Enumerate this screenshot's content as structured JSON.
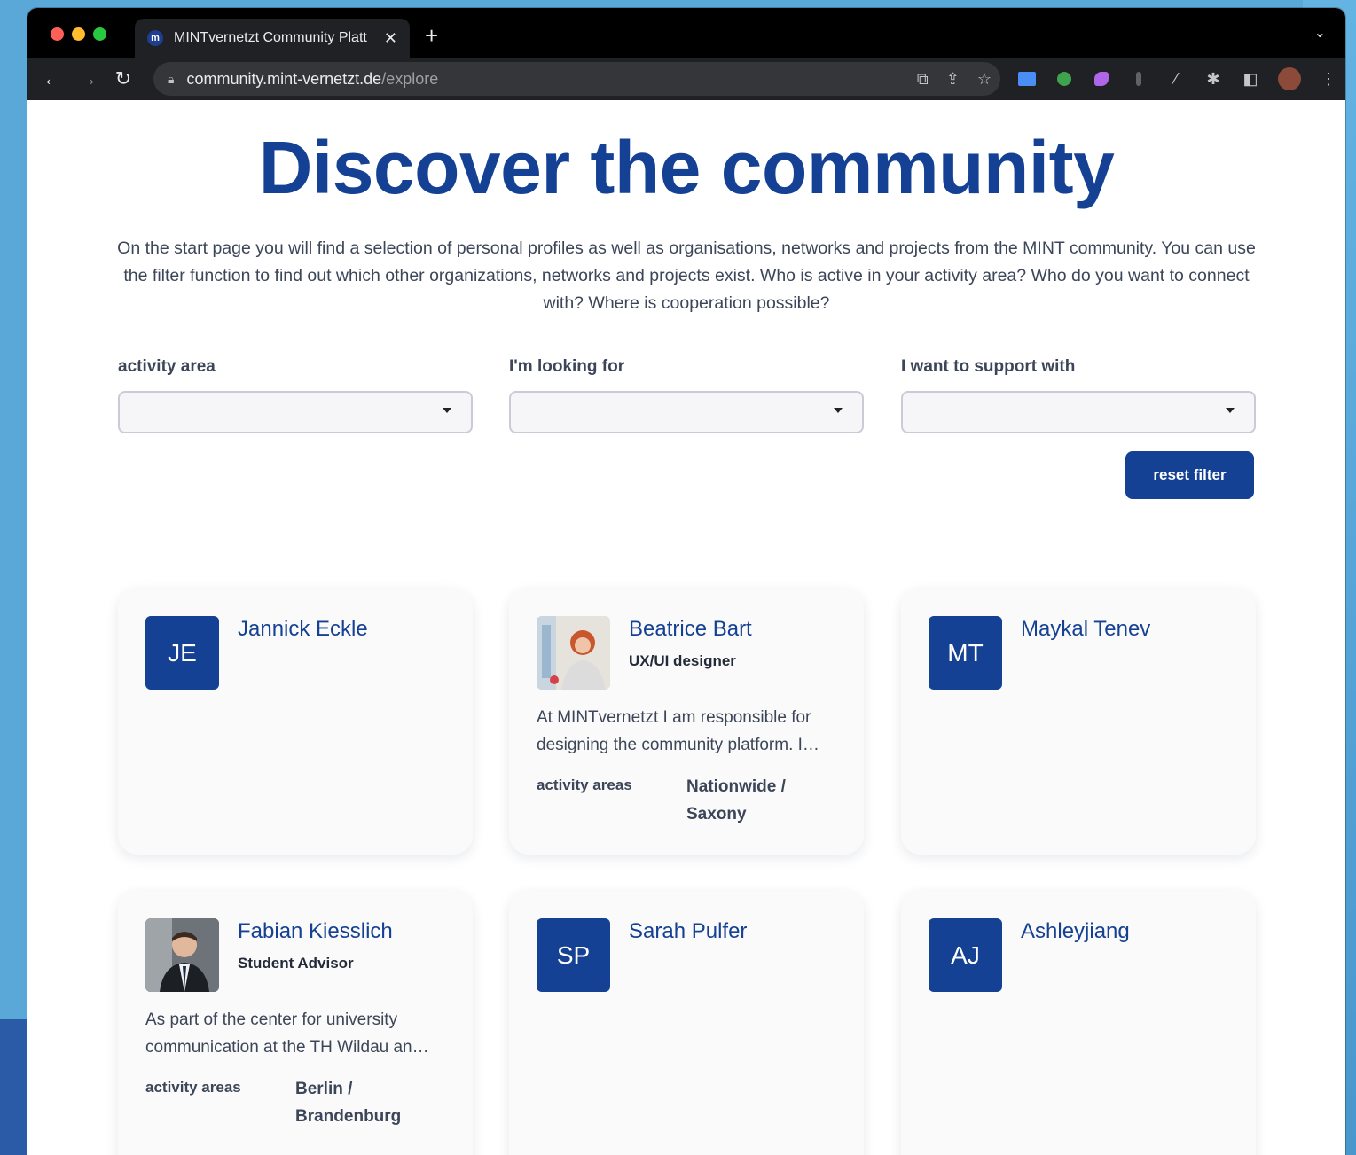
{
  "browser": {
    "tab_title": "MINTvernetzt Community Platt",
    "favicon_letter": "m",
    "url_host": "community.mint-vernetzt.de",
    "url_path": "/explore"
  },
  "page": {
    "title": "Discover the community",
    "intro": "On the start page you will find a selection of personal profiles as well as organisations, networks and projects from the MINT community. You can use the filter function to find out which other organizations, networks and projects exist. Who is active in your activity area? Who do you want to connect with? Where is cooperation possible?"
  },
  "filters": [
    {
      "label": "activity area",
      "value": ""
    },
    {
      "label": "I'm looking for",
      "value": ""
    },
    {
      "label": "I want to support with",
      "value": ""
    }
  ],
  "reset_label": "reset filter",
  "profiles": [
    {
      "initials": "JE",
      "name": "Jannick Eckle",
      "role": "",
      "bio": "",
      "areas_label": "",
      "areas": ""
    },
    {
      "initials": "",
      "name": "Beatrice Bart",
      "role": "UX/UI designer",
      "bio": "At MINTvernetzt I am responsible for designing the community platform. I…",
      "areas_label": "activity areas",
      "areas": "Nationwide / Saxony"
    },
    {
      "initials": "MT",
      "name": "Maykal Tenev",
      "role": "",
      "bio": "",
      "areas_label": "",
      "areas": ""
    },
    {
      "initials": "",
      "name": "Fabian Kiesslich",
      "role": "Student Advisor",
      "bio": "As part of the center for university communication at the TH Wildau an…",
      "areas_label": "activity areas",
      "areas": "Berlin / Brandenburg"
    },
    {
      "initials": "SP",
      "name": "Sarah Pulfer",
      "role": "",
      "bio": "",
      "areas_label": "",
      "areas": ""
    },
    {
      "initials": "AJ",
      "name": "Ashleyjiang",
      "role": "",
      "bio": "",
      "areas_label": "",
      "areas": ""
    }
  ],
  "colors": {
    "primary": "#154194",
    "text": "#3c4658"
  }
}
